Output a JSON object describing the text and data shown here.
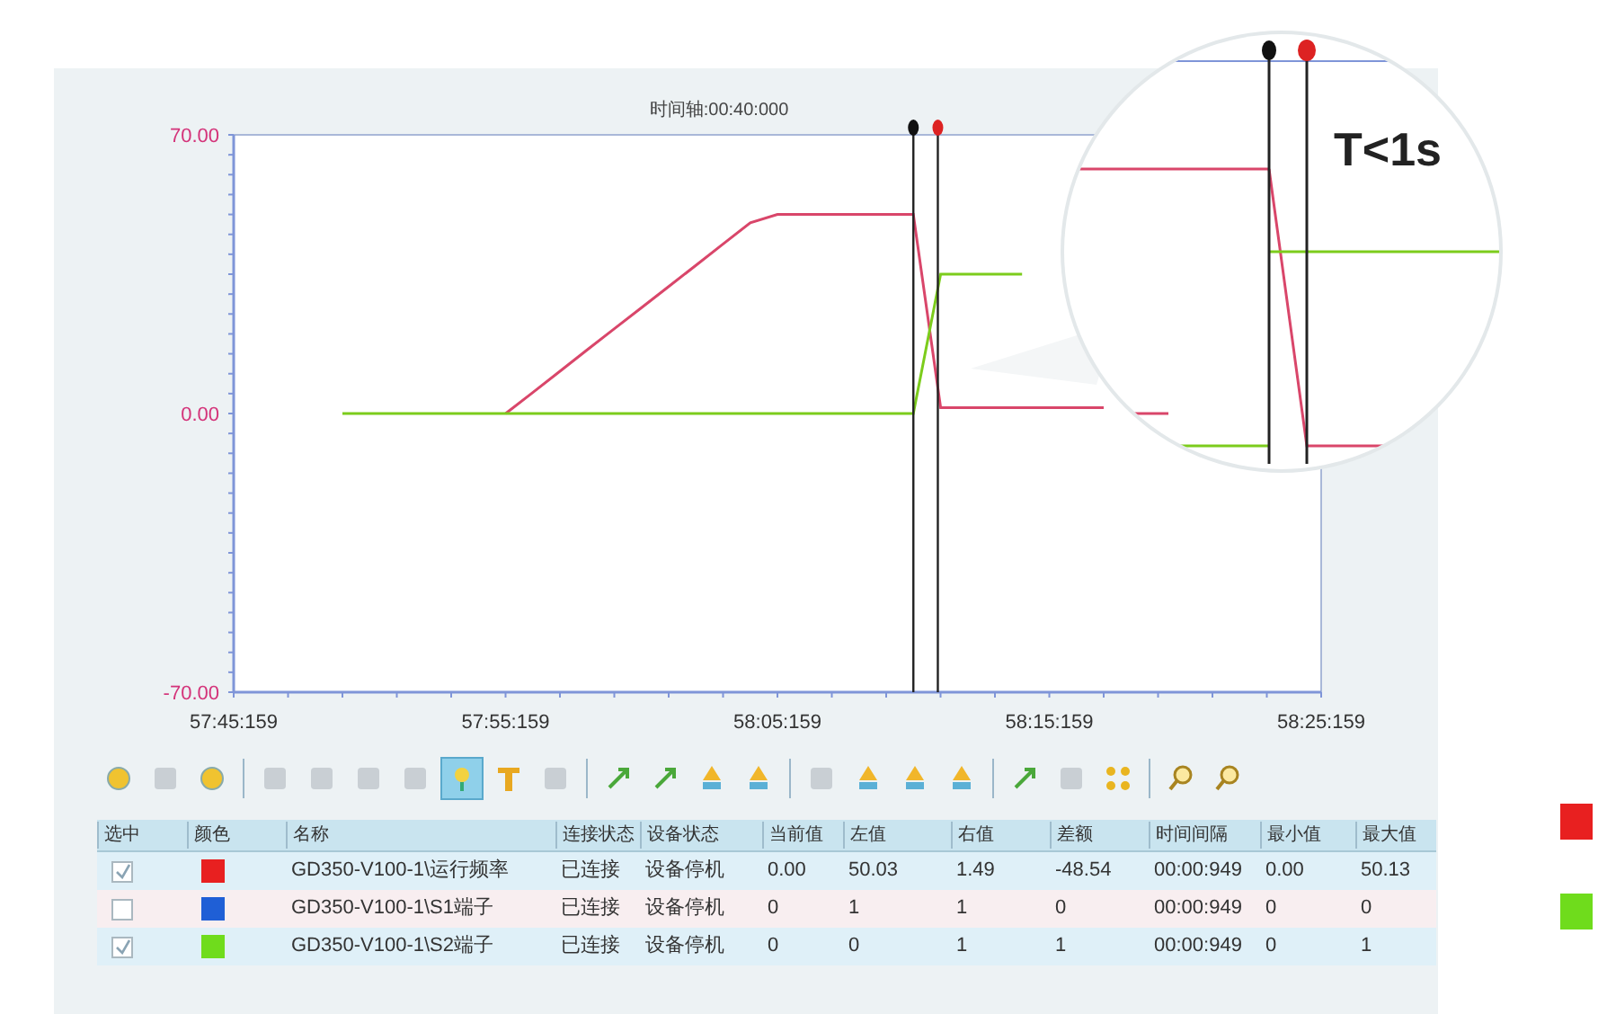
{
  "chart": {
    "title": "时间轴:00:40:000",
    "chart_data": {
      "type": "line",
      "categories": [
        "57:45:159",
        null,
        null,
        null,
        null,
        null,
        null,
        null,
        null,
        null,
        "57:55:159",
        null,
        null,
        null,
        null,
        null,
        null,
        null,
        null,
        null,
        "58:05:159",
        null,
        null,
        null,
        null,
        null,
        null,
        null,
        null,
        null,
        "58:15:159",
        null,
        null,
        null,
        null,
        null,
        null,
        null,
        null,
        null,
        "58:25:159"
      ],
      "series": [
        {
          "color": "#d9466a",
          "values": [
            null,
            null,
            null,
            null,
            null,
            null,
            null,
            null,
            null,
            null,
            0,
            5.3,
            10.6,
            16,
            21.3,
            26.6,
            31.9,
            37.2,
            42.6,
            47.9,
            50,
            50,
            50,
            50,
            50,
            50,
            1.5,
            1.5,
            1.5,
            1.5,
            1.5,
            1.5,
            1.5,
            null,
            null,
            null,
            null,
            null,
            null,
            null,
            null
          ]
        },
        {
          "color": "#7ccc1c",
          "values": [
            null,
            null,
            null,
            null,
            0,
            0,
            0,
            0,
            0,
            0,
            0,
            0,
            0,
            0,
            0,
            0,
            0,
            0,
            0,
            0,
            0,
            0,
            0,
            0,
            0,
            0,
            35,
            35,
            35,
            35,
            null,
            null,
            null,
            null,
            null,
            null,
            null,
            null,
            null,
            null,
            null
          ]
        }
      ],
      "ylim": [
        -70,
        70
      ],
      "yticks": [
        {
          "value": 70,
          "label": "70.00"
        },
        {
          "value": 0,
          "label": "0.00"
        },
        {
          "value": -70,
          "label": "-70.00"
        }
      ]
    },
    "cursors": [
      {
        "color": "#111111"
      },
      {
        "color": "#dd2222"
      }
    ]
  },
  "magnifier": {
    "label": "T<1s"
  },
  "toolbar": [
    {
      "kind": "dot",
      "selected": false
    },
    {
      "kind": "grey",
      "selected": false
    },
    {
      "kind": "dot",
      "selected": false
    },
    {
      "kind": "sep"
    },
    {
      "kind": "grey",
      "selected": false
    },
    {
      "kind": "grey",
      "selected": false
    },
    {
      "kind": "grey",
      "selected": false
    },
    {
      "kind": "grey",
      "selected": false
    },
    {
      "kind": "pin",
      "selected": true
    },
    {
      "kind": "text",
      "selected": false
    },
    {
      "kind": "grey",
      "selected": false
    },
    {
      "kind": "sep"
    },
    {
      "kind": "arrow",
      "selected": false
    },
    {
      "kind": "arrow",
      "selected": false
    },
    {
      "kind": "drop",
      "selected": false
    },
    {
      "kind": "drop",
      "selected": false
    },
    {
      "kind": "sep"
    },
    {
      "kind": "grey",
      "selected": false
    },
    {
      "kind": "drop",
      "selected": false
    },
    {
      "kind": "drop",
      "selected": false
    },
    {
      "kind": "drop",
      "selected": false
    },
    {
      "kind": "sep"
    },
    {
      "kind": "arrow",
      "selected": false
    },
    {
      "kind": "grey",
      "selected": false
    },
    {
      "kind": "grid",
      "selected": false
    },
    {
      "kind": "sep"
    },
    {
      "kind": "zoom",
      "selected": false
    },
    {
      "kind": "zoom",
      "selected": false
    }
  ],
  "table": {
    "columns": [
      "选中",
      "颜色",
      "名称",
      "连接状态",
      "设备状态",
      "当前值",
      "左值",
      "右值",
      "差额",
      "时间间隔",
      "最小值",
      "最大值"
    ],
    "rows": [
      {
        "checked": true,
        "color": "#e82020",
        "cells": [
          "",
          "",
          "GD350-V100-1\\运行频率",
          "已连接",
          "设备停机",
          "0.00",
          "50.03",
          "1.49",
          "-48.54",
          "00:00:949",
          "0.00",
          "50.13"
        ]
      },
      {
        "checked": false,
        "color": "#1f5fd6",
        "cells": [
          "",
          "",
          "GD350-V100-1\\S1端子",
          "已连接",
          "设备停机",
          "0",
          "1",
          "1",
          "0",
          "00:00:949",
          "0",
          "0"
        ]
      },
      {
        "checked": true,
        "color": "#6fdc1c",
        "cells": [
          "",
          "",
          "GD350-V100-1\\S2端子",
          "已连接",
          "设备停机",
          "0",
          "0",
          "1",
          "1",
          "00:00:949",
          "0",
          "1"
        ]
      }
    ]
  },
  "legend": [
    {
      "color": "#e82020"
    },
    {
      "color": "#6fdc1c"
    }
  ]
}
